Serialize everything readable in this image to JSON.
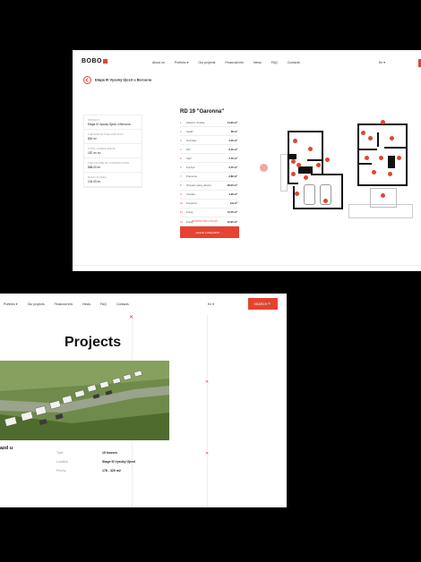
{
  "top_page": {
    "logo": "BOBO",
    "nav": [
      "About us",
      "Portfolio ▾",
      "Our projects",
      "Financial info",
      "News",
      "FAQ",
      "Contacts"
    ],
    "language": "En ▾",
    "breadcrumb": "Etapa III Vysoký Újezd u Berouna",
    "info": [
      {
        "label": "PROJECT",
        "value": "Etapa III Vysoký Újezd u Berouna"
      },
      {
        "label": "THE SIZE OF THE LAND PLOT",
        "value": "800 m²"
      },
      {
        "label": "TOTAL USABLE SPACE",
        "value": "187 m² m²"
      },
      {
        "label": "THE VOLUME OF CONSTRUCTION",
        "value": "888.00 m³"
      },
      {
        "label": "BUILT-UP AREA",
        "value": "104.00 m²"
      }
    ],
    "house_title": "RD 19 \"Garonna\"",
    "rooms": [
      {
        "n": "1",
        "name": "Zádveří, chodba",
        "area": "11,30 m²"
      },
      {
        "n": "2",
        "name": "Garáž",
        "area": "36 m²"
      },
      {
        "n": "3",
        "name": "Technika",
        "area": "4,10 m²"
      },
      {
        "n": "4",
        "name": "WC",
        "area": "2,10 m²"
      },
      {
        "n": "5",
        "name": "Spíž",
        "area": "7,70 m²"
      },
      {
        "n": "6",
        "name": "Kuchyň",
        "area": "3,70 m²"
      },
      {
        "n": "7",
        "name": "Pracovna",
        "area": "2,80 m²"
      },
      {
        "n": "8",
        "name": "Obývací pokoj, jídelna",
        "area": "36,00 m²"
      },
      {
        "n": "9",
        "name": "Chodba",
        "area": "4,00 m²"
      },
      {
        "n": "10",
        "name": "Koupelna",
        "area": "3,9 m²"
      },
      {
        "n": "11",
        "name": "Pokoj",
        "area": "11,70 m²"
      },
      {
        "n": "12",
        "name": "Pokoj",
        "area": "12,90 m²"
      }
    ],
    "download": "DOWNLOAD A PLAN  ↓",
    "cta": "LEAVE A REQUEST  →"
  },
  "bottom_page": {
    "nav": [
      "Portfolio ▾",
      "Our projects",
      "Financial info",
      "News",
      "FAQ",
      "Contacts"
    ],
    "language": "En ▾",
    "search": "SEARCH  🔍",
    "title": "Projects",
    "project_name": "azd u",
    "specs": [
      {
        "label": "Type",
        "value": "15 houses"
      },
      {
        "label": "Location",
        "value": "Stage III Vysoký Újezd"
      },
      {
        "label": "Plochy",
        "value": "178 - 320 m2"
      }
    ]
  },
  "colors": {
    "accent": "#e5432f",
    "background": "#000000",
    "grass": "#5d7a3a"
  }
}
